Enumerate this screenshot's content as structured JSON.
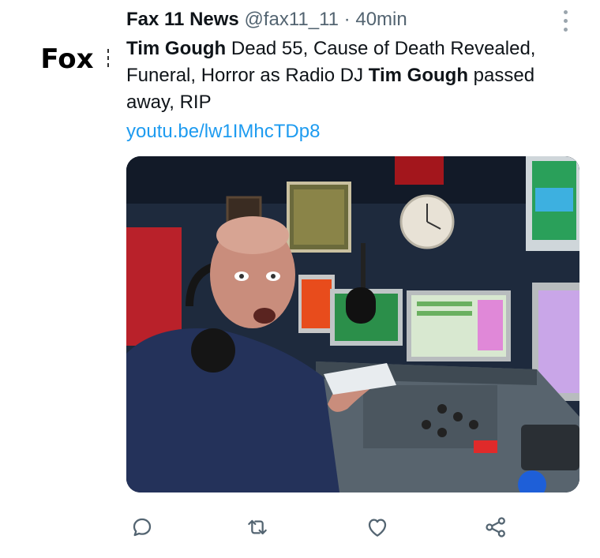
{
  "avatar": {
    "text": "Fox"
  },
  "tweet": {
    "display_name": "Fax 11 News",
    "handle": "@fax11_11",
    "separator": "·",
    "time": "40min",
    "body": {
      "bold1": "Tim Gough",
      "text1": " Dead 55, Cause of Death Revealed, Funeral, Horror as Radio DJ ",
      "bold2": "Tim Gough",
      "text2": " passed away, RIP"
    },
    "link": "youtu.be/lw1IMhcTDp8"
  },
  "actions": [
    {
      "icon": "reply-icon"
    },
    {
      "icon": "retweet-icon"
    },
    {
      "icon": "like-icon"
    },
    {
      "icon": "share-icon"
    }
  ],
  "colors": {
    "link": "#1d9bf0",
    "secondary_text": "#536471",
    "icon": "#536471"
  }
}
